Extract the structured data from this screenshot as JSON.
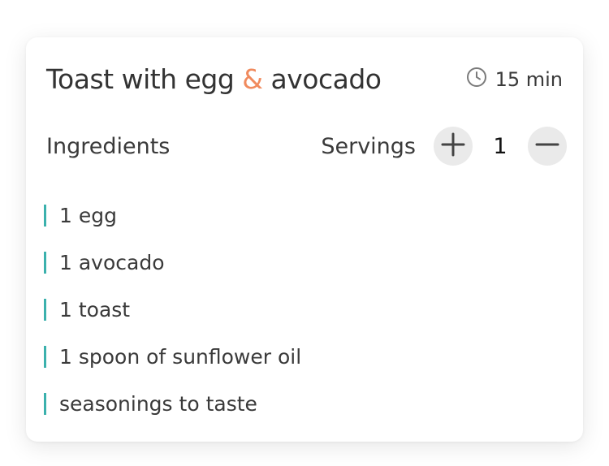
{
  "recipe": {
    "title_part1": "Toast with egg ",
    "title_amp": "&",
    "title_part2": " avocado",
    "time": "15 min",
    "time_icon": "clock-icon",
    "ingredients_heading": "Ingredients",
    "servings_label": "Servings",
    "servings_count": "1",
    "increase_icon": "plus-icon",
    "decrease_icon": "minus-icon",
    "ingredients": [
      "1 egg",
      "1 avocado",
      "1 toast",
      "1 spoon of sunflower oil",
      "seasonings to taste"
    ]
  },
  "colors": {
    "accent": "#f08a5d",
    "list_marker": "#3bb1ad",
    "button_bg": "#eaeaea"
  }
}
